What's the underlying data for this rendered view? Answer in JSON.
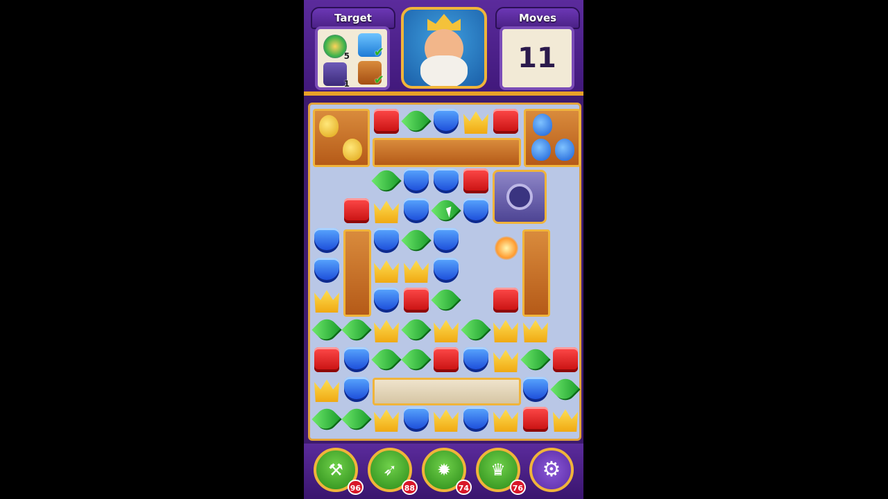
{
  "header": {
    "target_title": "Target",
    "moves_title": "Moves",
    "moves_value": "11",
    "targets": [
      {
        "name": "jar-target",
        "count": "5",
        "done": false
      },
      {
        "name": "tile-target",
        "count": "",
        "done": true
      },
      {
        "name": "box-target",
        "count": "1",
        "done": false
      },
      {
        "name": "wood-target",
        "count": "",
        "done": true
      }
    ],
    "check_glyph": "✔"
  },
  "board": {
    "rows": [
      [
        "",
        "",
        "red",
        "green",
        "blue",
        "crown",
        "red",
        "",
        ""
      ],
      [
        "",
        "",
        "",
        "",
        "",
        "",
        "",
        "",
        ""
      ],
      [
        "",
        "",
        "green",
        "blue",
        "blue",
        "red",
        "",
        "",
        ""
      ],
      [
        "",
        "red",
        "crown",
        "blue",
        "green",
        "blue",
        "",
        "",
        ""
      ],
      [
        "blue",
        "",
        "blue",
        "green",
        "blue",
        "",
        "",
        "",
        ""
      ],
      [
        "blue",
        "",
        "crown",
        "crown",
        "blue",
        "",
        "",
        "",
        ""
      ],
      [
        "crown",
        "",
        "blue",
        "red",
        "green",
        "",
        "red",
        "",
        ""
      ],
      [
        "green",
        "green",
        "crown",
        "green",
        "crown",
        "green",
        "crown",
        "crown",
        ""
      ],
      [
        "red",
        "blue",
        "green",
        "green",
        "red",
        "blue",
        "crown",
        "green",
        "red"
      ],
      [
        "crown",
        "blue",
        "",
        "",
        "",
        "",
        "",
        "blue",
        "green"
      ],
      [
        "green",
        "green",
        "crown",
        "blue",
        "crown",
        "blue",
        "crown",
        "red",
        "crown"
      ]
    ]
  },
  "boosters": [
    {
      "name": "hammer",
      "icon": "⚒",
      "count": "96"
    },
    {
      "name": "arrow",
      "icon": "➶",
      "count": "88"
    },
    {
      "name": "cannon",
      "icon": "✹",
      "count": "74"
    },
    {
      "name": "jester",
      "icon": "♛",
      "count": "76"
    }
  ],
  "settings_icon": "⚙"
}
